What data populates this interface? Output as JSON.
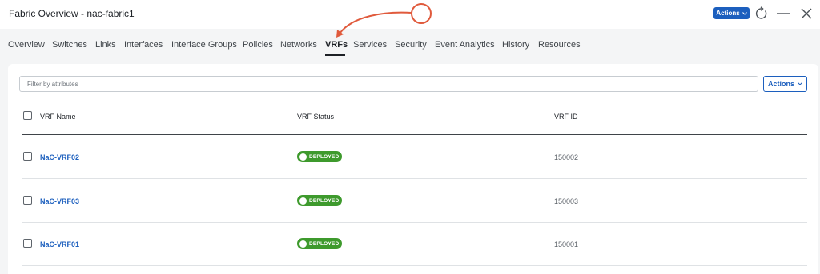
{
  "header": {
    "title": "Fabric Overview - nac-fabric1",
    "actions_label": "Actions"
  },
  "tabs": [
    {
      "label": "Overview"
    },
    {
      "label": "Switches"
    },
    {
      "label": "Links"
    },
    {
      "label": "Interfaces"
    },
    {
      "label": "Interface Groups"
    },
    {
      "label": "Policies"
    },
    {
      "label": "Networks"
    },
    {
      "label": "VRFs",
      "active": true
    },
    {
      "label": "Services"
    },
    {
      "label": "Security"
    },
    {
      "label": "Event Analytics"
    },
    {
      "label": "History"
    },
    {
      "label": "Resources"
    }
  ],
  "toolbar": {
    "filter_placeholder": "Filter by attributes",
    "actions_label": "Actions"
  },
  "table": {
    "columns": [
      "VRF Name",
      "VRF Status",
      "VRF ID"
    ],
    "rows": [
      {
        "name": "NaC-VRF02",
        "status": "DEPLOYED",
        "id": "150002"
      },
      {
        "name": "NaC-VRF03",
        "status": "DEPLOYED",
        "id": "150003"
      },
      {
        "name": "NaC-VRF01",
        "status": "DEPLOYED",
        "id": "150001"
      }
    ]
  },
  "colors": {
    "accent": "#1c5fbe",
    "deployed": "#3e9a2d",
    "annotation": "#e05a3c"
  },
  "icons": [
    "refresh-icon",
    "minimize-icon",
    "close-icon",
    "chevron-down-icon",
    "annotation-arrow",
    "annotation-circle"
  ]
}
